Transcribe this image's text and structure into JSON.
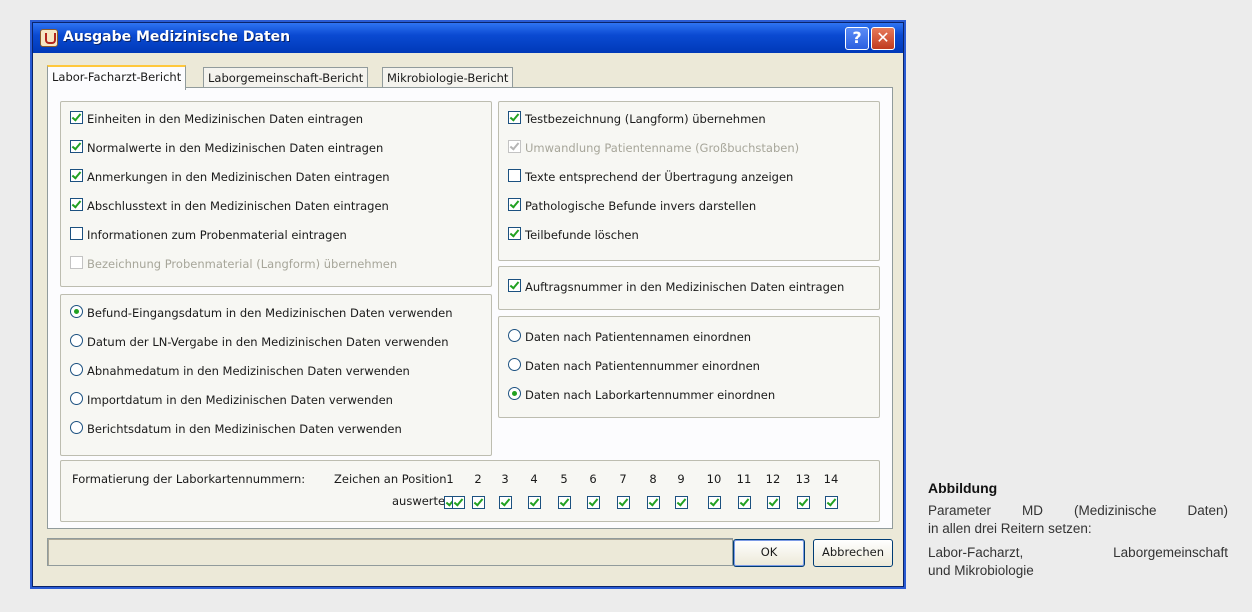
{
  "dialog": {
    "title": "Ausgabe Medizinische Daten",
    "help_glyph": "?",
    "close_glyph": "✕",
    "tabs": [
      {
        "label": "Labor-Facharzt-Bericht",
        "active": true
      },
      {
        "label": "Laborgemeinschaft-Bericht",
        "active": false
      },
      {
        "label": "Mikrobiologie-Bericht",
        "active": false
      }
    ],
    "left_checkboxes": [
      {
        "label": "Einheiten in den Medizinischen Daten eintragen",
        "checked": true,
        "enabled": true
      },
      {
        "label": "Normalwerte in den Medizinischen Daten eintragen",
        "checked": true,
        "enabled": true
      },
      {
        "label": "Anmerkungen in den Medizinischen Daten eintragen",
        "checked": true,
        "enabled": true
      },
      {
        "label": "Abschlusstext in den Medizinischen Daten eintragen",
        "checked": true,
        "enabled": true
      },
      {
        "label": "Informationen zum Probenmaterial eintragen",
        "checked": false,
        "enabled": true
      },
      {
        "label": "Bezeichnung Probenmaterial (Langform) übernehmen",
        "checked": false,
        "enabled": false
      }
    ],
    "right_checkboxes": [
      {
        "label": "Testbezeichnung (Langform) übernehmen",
        "checked": true,
        "enabled": true
      },
      {
        "label": "Umwandlung Patientenname (Großbuchstaben)",
        "checked": true,
        "enabled": false
      },
      {
        "label": "Texte entsprechend der Übertragung anzeigen",
        "checked": false,
        "enabled": true
      },
      {
        "label": "Pathologische Befunde invers darstellen",
        "checked": true,
        "enabled": true
      },
      {
        "label": "Teilbefunde löschen",
        "checked": true,
        "enabled": true
      }
    ],
    "auftrag_checkbox": {
      "label": "Auftragsnummer in den Medizinischen Daten eintragen",
      "checked": true
    },
    "date_radios": [
      {
        "label": "Befund-Eingangsdatum in den Medizinischen Daten verwenden",
        "selected": true
      },
      {
        "label": "Datum der LN-Vergabe in den Medizinischen Daten verwenden",
        "selected": false
      },
      {
        "label": "Abnahmedatum in den Medizinischen Daten verwenden",
        "selected": false
      },
      {
        "label": "Importdatum in den Medizinischen Daten verwenden",
        "selected": false
      },
      {
        "label": "Berichtsdatum in den Medizinischen Daten verwenden",
        "selected": false
      }
    ],
    "sort_radios": [
      {
        "label": "Daten nach Patientennamen einordnen",
        "selected": false
      },
      {
        "label": "Daten nach Patientennummer einordnen",
        "selected": false
      },
      {
        "label": "Daten nach Laborkartennummer einordnen",
        "selected": true
      }
    ],
    "format": {
      "label": "Formatierung der Laborkartennummern:",
      "position_label": "Zeichen an Position",
      "evaluate_label": "auswerten",
      "positions": [
        "1",
        "2",
        "3",
        "4",
        "5",
        "6",
        "7",
        "8",
        "9",
        "10",
        "11",
        "12",
        "13",
        "14"
      ],
      "checked": [
        true,
        true,
        true,
        true,
        true,
        true,
        true,
        true,
        true,
        true,
        true,
        true,
        true,
        true
      ]
    },
    "ok_label": "OK",
    "cancel_label": "Abbrechen"
  },
  "caption": {
    "title": "Abbildung",
    "line1": "Parameter MD (Medizinische Daten)",
    "line2": "in allen drei Reitern setzen:",
    "line3": "Labor-Facharzt, Laborgemeinschaft",
    "line4": "und Mikrobiologie"
  },
  "colors": {
    "title_bar": "#0a4ad2",
    "dialog_bg": "#ece9d8",
    "check": "#21a121"
  }
}
